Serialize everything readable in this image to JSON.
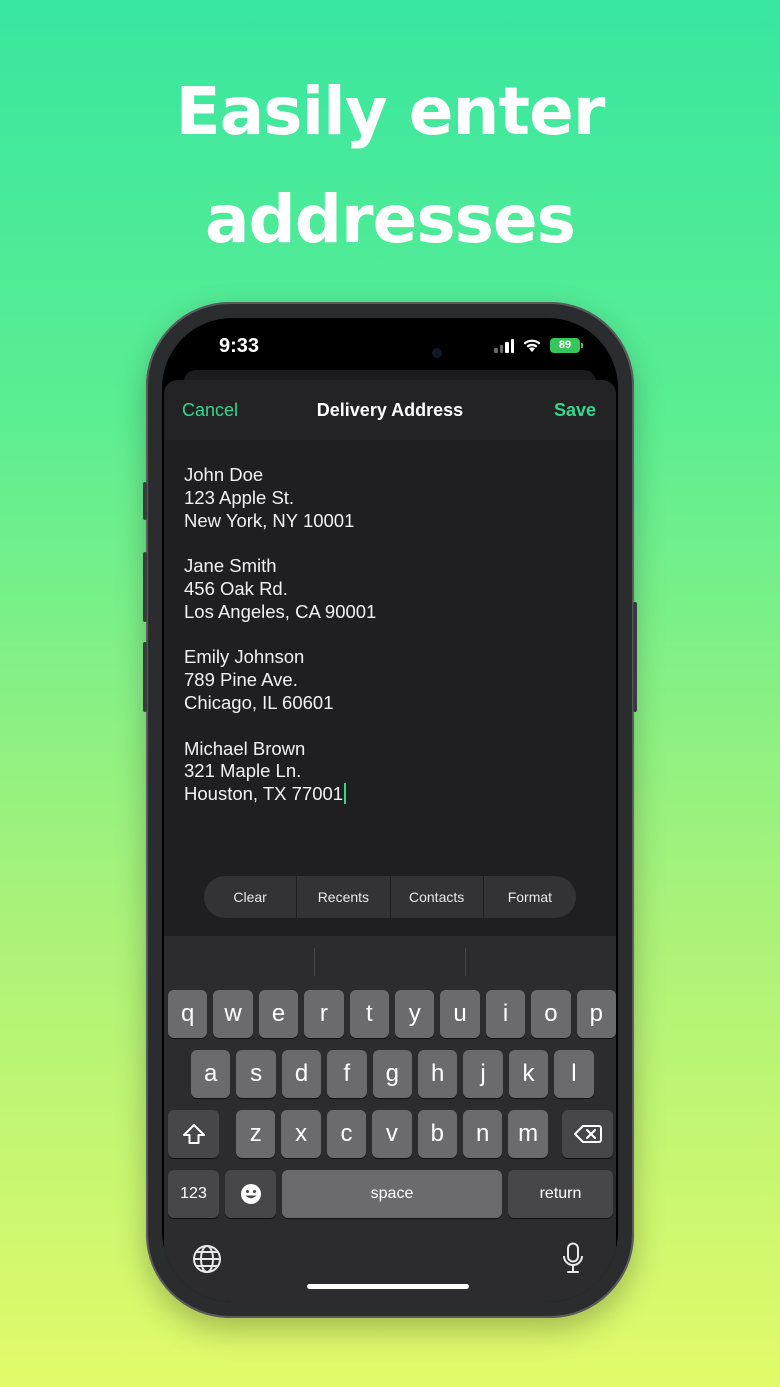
{
  "headline": {
    "line1": "Easily enter",
    "line2": "addresses"
  },
  "status_bar": {
    "time": "9:33",
    "battery": "89"
  },
  "nav": {
    "cancel": "Cancel",
    "title": "Delivery Address",
    "save": "Save"
  },
  "addresses": [
    {
      "name": "John Doe",
      "street": "123 Apple St.",
      "city": "New York, NY 10001"
    },
    {
      "name": "Jane Smith",
      "street": "456 Oak Rd.",
      "city": "Los Angeles, CA 90001"
    },
    {
      "name": "Emily Johnson",
      "street": "789 Pine Ave.",
      "city": "Chicago, IL 60601"
    },
    {
      "name": "Michael Brown",
      "street": "321 Maple Ln.",
      "city": "Houston, TX 77001"
    }
  ],
  "toolbar": {
    "clear": "Clear",
    "recents": "Recents",
    "contacts": "Contacts",
    "format": "Format"
  },
  "keyboard": {
    "row1": [
      "q",
      "w",
      "e",
      "r",
      "t",
      "y",
      "u",
      "i",
      "o",
      "p"
    ],
    "row2": [
      "a",
      "s",
      "d",
      "f",
      "g",
      "h",
      "j",
      "k",
      "l"
    ],
    "row3": [
      "z",
      "x",
      "c",
      "v",
      "b",
      "n",
      "m"
    ],
    "numbers": "123",
    "space": "space",
    "return": "return"
  },
  "icons": {
    "shift": "shift-icon",
    "delete": "delete-icon",
    "emoji": "emoji-icon",
    "globe": "globe-icon",
    "mic": "microphone-icon",
    "wifi": "wifi-icon",
    "signal": "signal-icon",
    "battery": "battery-icon"
  },
  "colors": {
    "accent": "#35d78c",
    "battery": "#35c759"
  }
}
